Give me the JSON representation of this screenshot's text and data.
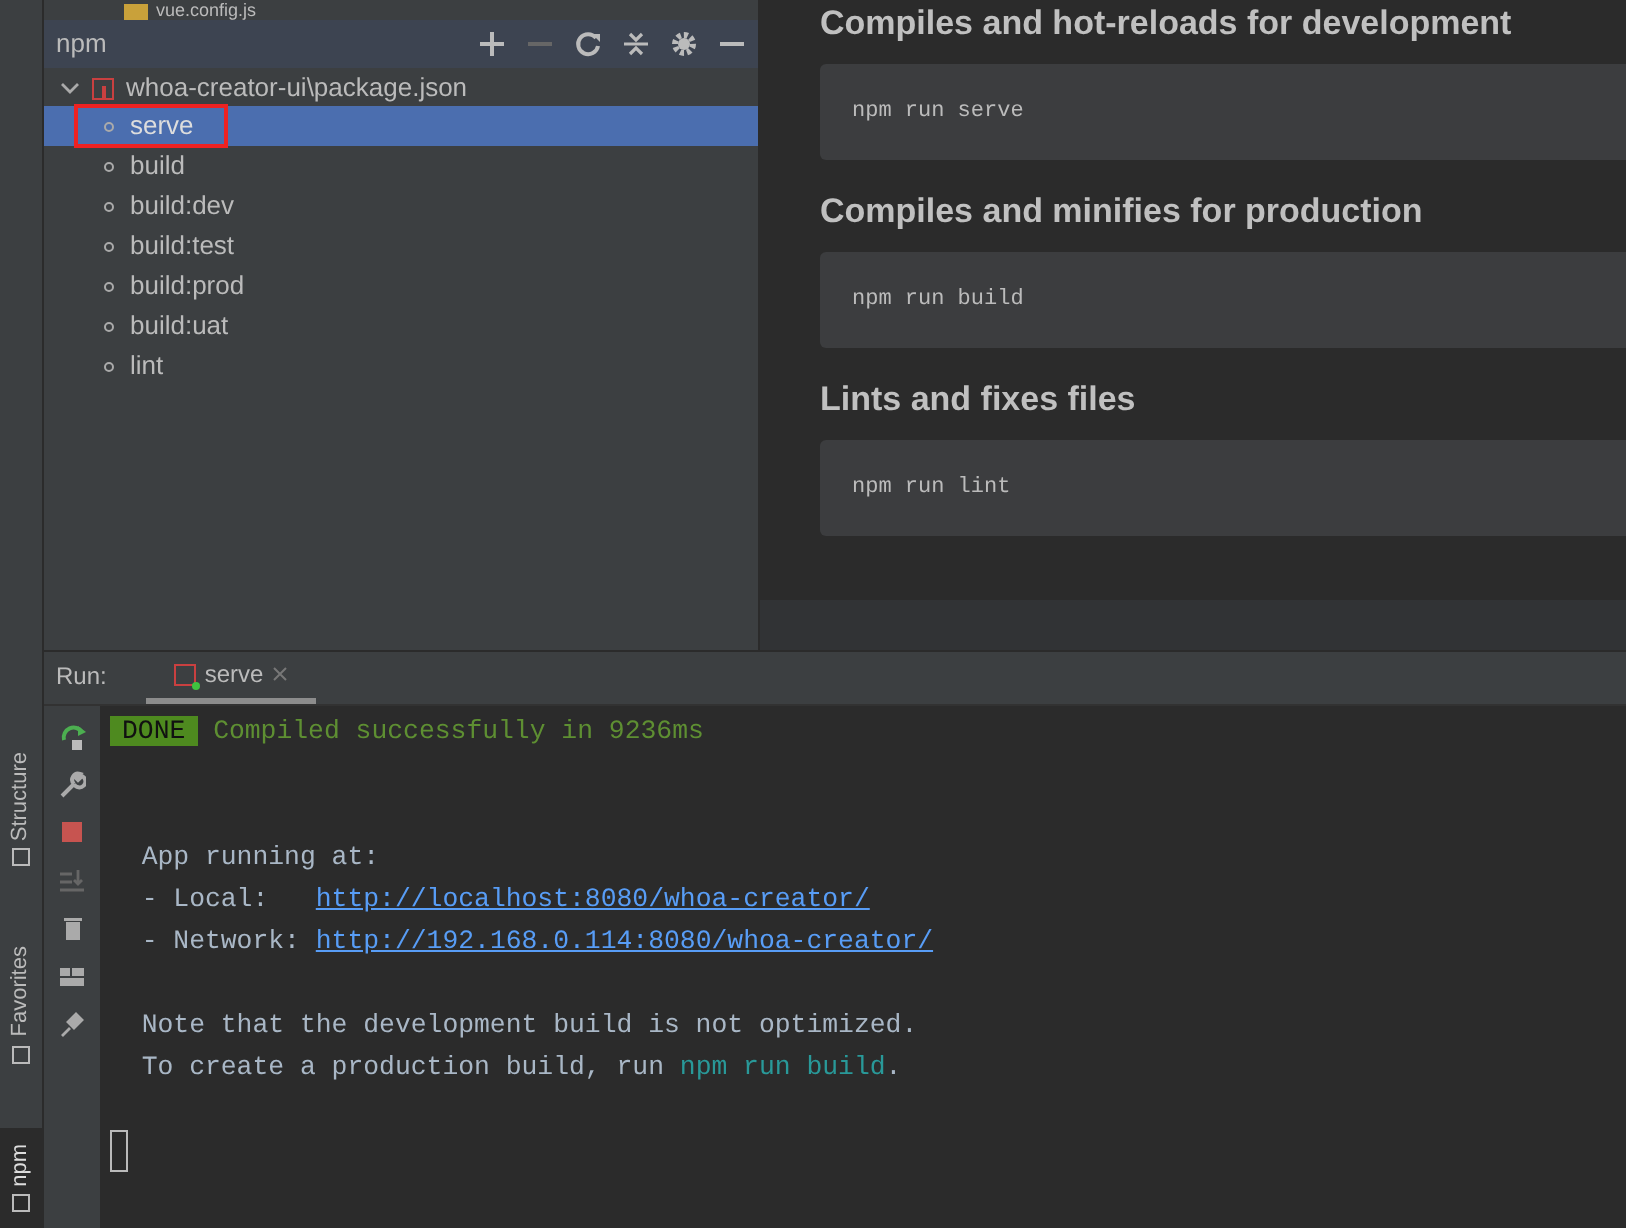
{
  "project_tree": {
    "partial_file": "vue.config.js"
  },
  "side_tabs": [
    {
      "label": "Structure",
      "selected": false
    },
    {
      "label": "Favorites",
      "selected": false
    },
    {
      "label": "npm",
      "selected": true
    }
  ],
  "npm_panel": {
    "title": "npm",
    "package": {
      "label": "whoa-creator-ui\\package.json",
      "expanded": true,
      "scripts": [
        {
          "label": "serve",
          "selected": true,
          "annotated": true
        },
        {
          "label": "build",
          "selected": false,
          "annotated": false
        },
        {
          "label": "build:dev",
          "selected": false,
          "annotated": false
        },
        {
          "label": "build:test",
          "selected": false,
          "annotated": false
        },
        {
          "label": "build:prod",
          "selected": false,
          "annotated": false
        },
        {
          "label": "build:uat",
          "selected": false,
          "annotated": false
        },
        {
          "label": "lint",
          "selected": false,
          "annotated": false
        }
      ]
    }
  },
  "readme": {
    "sections": [
      {
        "heading": "Compiles and hot-reloads for development",
        "code": "npm run serve"
      },
      {
        "heading": "Compiles and minifies for production",
        "code": "npm run build"
      },
      {
        "heading": "Lints and fixes files",
        "code": "npm run lint"
      }
    ]
  },
  "run_panel": {
    "label": "Run:",
    "tabs": [
      {
        "label": "serve",
        "selected": true
      }
    ],
    "console": [
      {
        "kind": "line",
        "segments": [
          {
            "kind": "badge",
            "text": "DONE"
          },
          {
            "kind": "success",
            "text": " Compiled successfully in 9236ms"
          }
        ]
      },
      {
        "kind": "blank"
      },
      {
        "kind": "blank"
      },
      {
        "kind": "line",
        "segments": [
          {
            "kind": "plain",
            "text": "  App running at:"
          }
        ]
      },
      {
        "kind": "line",
        "segments": [
          {
            "kind": "plain",
            "text": "  - Local:   "
          },
          {
            "kind": "link",
            "text": "http://localhost:8080/whoa-creator/"
          }
        ]
      },
      {
        "kind": "line",
        "segments": [
          {
            "kind": "plain",
            "text": "  - Network: "
          },
          {
            "kind": "link",
            "text": "http://192.168.0.114:8080/whoa-creator/"
          }
        ]
      },
      {
        "kind": "blank"
      },
      {
        "kind": "line",
        "segments": [
          {
            "kind": "plain",
            "text": "  Note that the development build is not optimized."
          }
        ]
      },
      {
        "kind": "line",
        "segments": [
          {
            "kind": "plain",
            "text": "  To create a production build, run "
          },
          {
            "kind": "command",
            "text": "npm run build"
          },
          {
            "kind": "plain",
            "text": "."
          }
        ]
      },
      {
        "kind": "blank"
      },
      {
        "kind": "cursor"
      }
    ]
  }
}
